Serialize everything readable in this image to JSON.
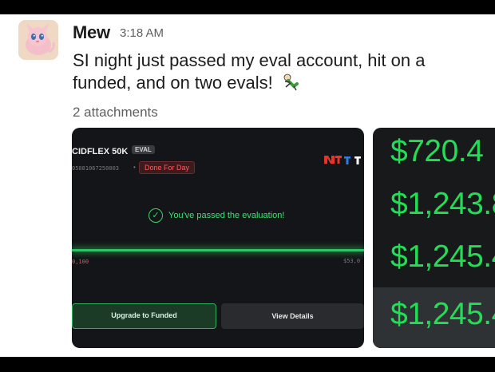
{
  "message": {
    "author": "Mew",
    "timestamp": "3:18 AM",
    "text": "SI night just passed my eval account, hit on a funded, and on two evals!",
    "emoji": "dancing-person",
    "attachments_label": "2 attachments"
  },
  "attachment1": {
    "account_title": "CIDFLEX 50K",
    "eval_badge": "EVAL",
    "account_id": "05081067250003",
    "status_badge": "Done For Day",
    "passed_text": "You've passed the evaluation!",
    "left_amount": "0,100",
    "right_amount": "$53,0",
    "upgrade_button": "Upgrade to Funded",
    "details_button": "View Details",
    "accent_color": "#2ec266"
  },
  "attachment2": {
    "values": [
      "$720.4",
      "$1,243.8",
      "$1,245.4",
      "$1,245.4"
    ],
    "value_color": "#22dd55"
  }
}
